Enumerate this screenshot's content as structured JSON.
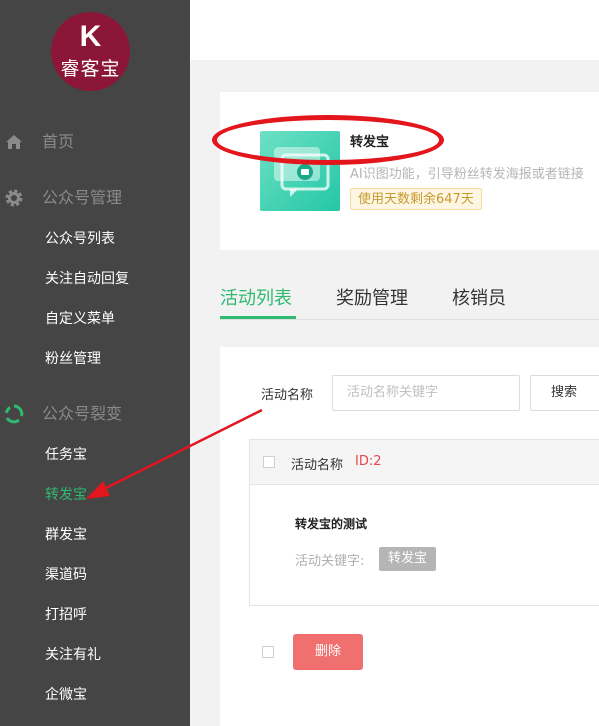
{
  "logo": {
    "mark": "K",
    "text": "睿客宝"
  },
  "sidebar": {
    "sections": [
      {
        "label": "首页",
        "icon": "home-icon"
      },
      {
        "label": "公众号管理",
        "icon": "gear-icon"
      },
      {
        "label": "公众号裂变",
        "icon": "fission-icon"
      }
    ],
    "items": [
      {
        "label": "公众号列表"
      },
      {
        "label": "关注自动回复"
      },
      {
        "label": "自定义菜单"
      },
      {
        "label": "粉丝管理"
      },
      {
        "label": "任务宝"
      },
      {
        "label": "转发宝"
      },
      {
        "label": "群发宝"
      },
      {
        "label": "渠道码"
      },
      {
        "label": "打招呼"
      },
      {
        "label": "关注有礼"
      },
      {
        "label": "企微宝"
      }
    ]
  },
  "app": {
    "title": "转发宝",
    "description": "AI识图功能，引导粉丝转发海报或者链接",
    "days_left": "使用天数剩余647天"
  },
  "tabs": [
    {
      "label": "活动列表"
    },
    {
      "label": "奖励管理"
    },
    {
      "label": "核销员"
    }
  ],
  "search": {
    "label": "活动名称",
    "placeholder": "活动名称关键字",
    "button": "搜索"
  },
  "list": {
    "header_label": "活动名称",
    "header_id": "ID:2",
    "activity_name": "转发宝的测试",
    "keyword_label": "活动关键字:",
    "keyword_tag": "转发宝"
  },
  "actions": {
    "delete": "删除"
  },
  "colors": {
    "accent": "#2fba6f",
    "sidebar_bg": "#454545",
    "annotation_red": "#e3161d",
    "delete": "#f07070"
  }
}
